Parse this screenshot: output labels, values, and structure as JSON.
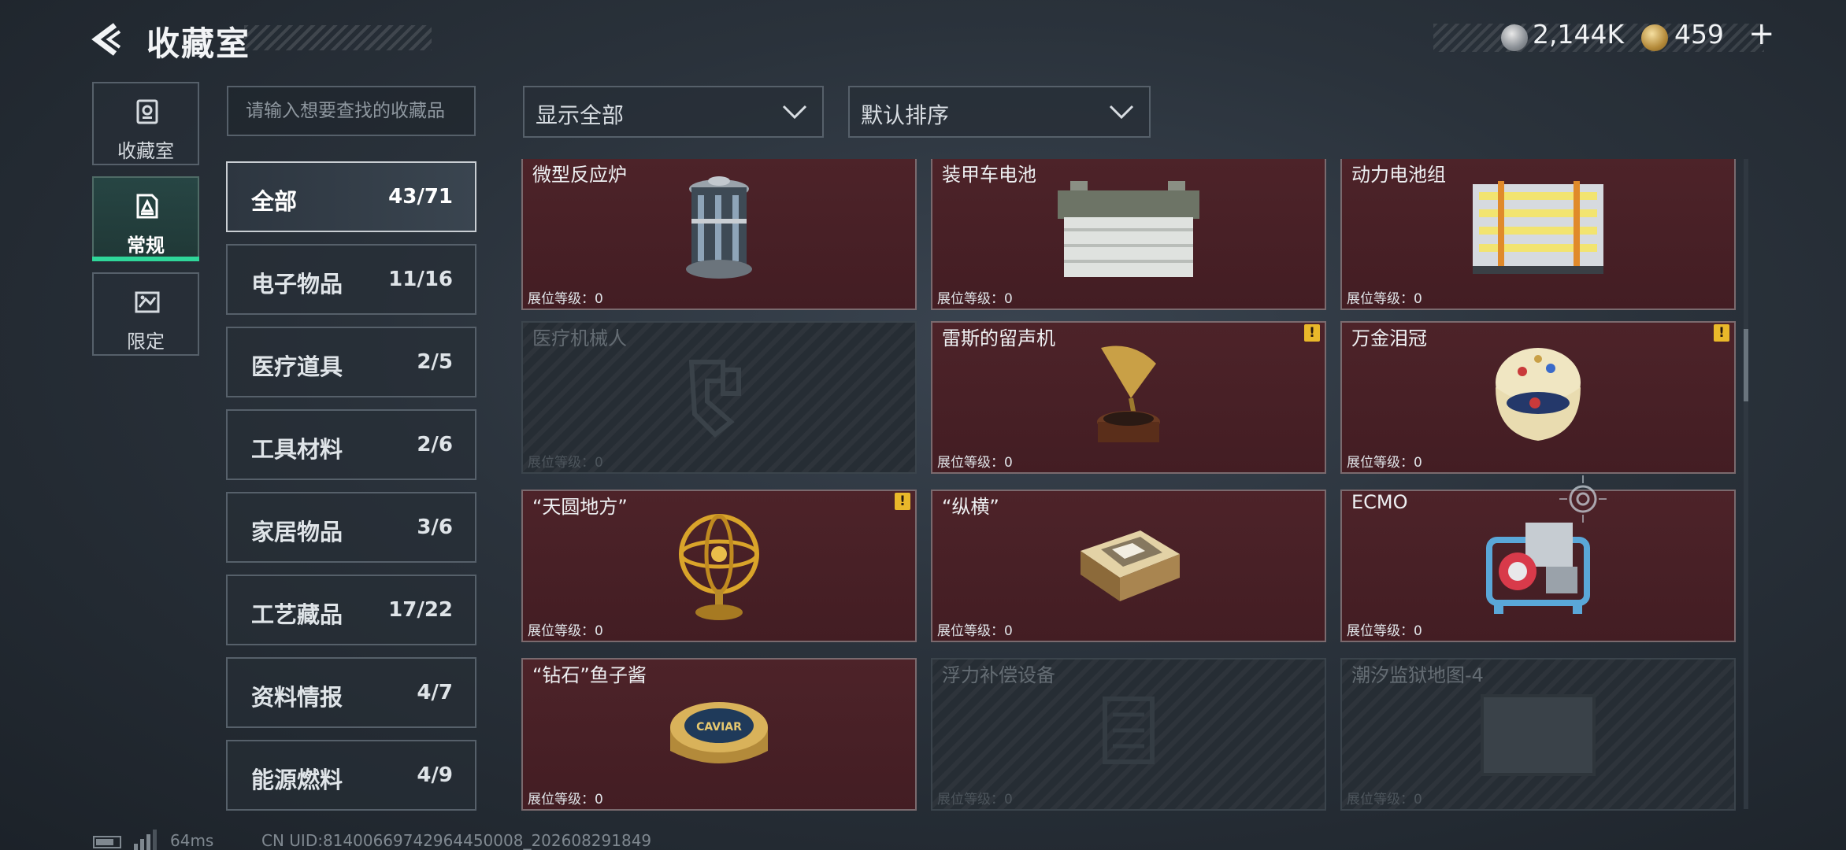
{
  "header": {
    "title": "收藏室",
    "currency": [
      {
        "icon": "silver-coin-icon",
        "value": "2,144K"
      },
      {
        "icon": "gold-coin-icon",
        "value": "459"
      }
    ],
    "plus_label": "+"
  },
  "nav": [
    {
      "label": "收藏室",
      "icon": "collection-room-icon"
    },
    {
      "label": "常规",
      "icon": "regular-icon",
      "active": true
    },
    {
      "label": "限定",
      "icon": "limited-icon"
    }
  ],
  "search": {
    "placeholder": "请输入想要查找的收藏品"
  },
  "categories": [
    {
      "name": "全部",
      "count": "43/71",
      "active": true
    },
    {
      "name": "电子物品",
      "count": "11/16"
    },
    {
      "name": "医疗道具",
      "count": "2/5"
    },
    {
      "name": "工具材料",
      "count": "2/6"
    },
    {
      "name": "家居物品",
      "count": "3/6"
    },
    {
      "name": "工艺藏品",
      "count": "17/22"
    },
    {
      "name": "资料情报",
      "count": "4/7"
    },
    {
      "name": "能源燃料",
      "count": "4/9"
    }
  ],
  "filters": {
    "show": "显示全部",
    "sort": "默认排序"
  },
  "level_label": "展位等级：0",
  "items": [
    {
      "name": "微型反应炉",
      "owned": true,
      "warning": false,
      "icon": "micro-reactor-icon"
    },
    {
      "name": "装甲车电池",
      "owned": true,
      "warning": false,
      "icon": "armored-battery-icon"
    },
    {
      "name": "动力电池组",
      "owned": true,
      "warning": false,
      "icon": "power-battery-pack-icon"
    },
    {
      "name": "医疗机械人",
      "owned": false,
      "warning": false,
      "icon": "medical-robot-icon"
    },
    {
      "name": "雷斯的留声机",
      "owned": true,
      "warning": true,
      "icon": "gramophone-icon"
    },
    {
      "name": "万金泪冠",
      "owned": true,
      "warning": true,
      "icon": "jeweled-egg-icon"
    },
    {
      "name": "“天圆地方”",
      "owned": true,
      "warning": true,
      "icon": "armillary-sphere-icon"
    },
    {
      "name": "“纵横”",
      "owned": true,
      "warning": false,
      "icon": "chess-box-icon"
    },
    {
      "name": "ECMO",
      "owned": true,
      "warning": false,
      "icon": "ecmo-machine-icon"
    },
    {
      "name": "“钻石”鱼子酱",
      "owned": true,
      "warning": false,
      "icon": "caviar-tin-icon"
    },
    {
      "name": "浮力补偿设备",
      "owned": false,
      "warning": false,
      "icon": "buoyancy-device-icon"
    },
    {
      "name": "潮汐监狱地图-4",
      "owned": false,
      "warning": false,
      "icon": "prison-map-icon"
    }
  ],
  "caviar_text": "CAVIAR",
  "warning_glyph": "!",
  "footer": {
    "ping": "64ms",
    "uid": "CN UID:8140066974296445000​8_202608291849"
  }
}
